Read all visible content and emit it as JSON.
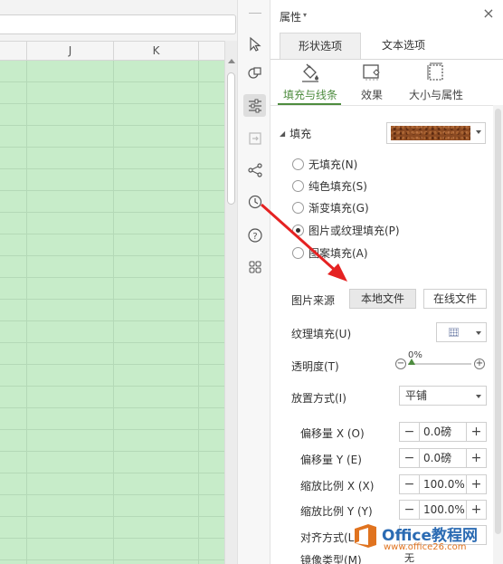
{
  "sheet": {
    "columns": [
      "J",
      "K"
    ]
  },
  "panel": {
    "title": "属性",
    "title_caret": "▾",
    "close": "×",
    "tabs": [
      "形状选项",
      "文本选项"
    ],
    "subtabs": [
      "填充与线条",
      "效果",
      "大小与属性"
    ],
    "fill": {
      "section_label": "填充",
      "section_caret": "◢",
      "options": [
        {
          "label": "无填充(N)",
          "checked": false
        },
        {
          "label": "纯色填充(S)",
          "checked": false
        },
        {
          "label": "渐变填充(G)",
          "checked": false
        },
        {
          "label": "图片或纹理填充(P)",
          "checked": true
        },
        {
          "label": "图案填充(A)",
          "checked": false
        }
      ],
      "picture_source_label": "图片来源",
      "local_file_button": "本地文件",
      "online_file_button": "在线文件",
      "texture_label": "纹理填充(U)",
      "opacity_label": "透明度(T)",
      "opacity_value": "0%",
      "opacity_fraction": 0,
      "placement_label": "放置方式(I)",
      "placement_value": "平铺",
      "offset_x_label": "偏移量 X (O)",
      "offset_x_value": "0.0磅",
      "offset_y_label": "偏移量 Y (E)",
      "offset_y_value": "0.0磅",
      "scale_x_label": "缩放比例 X (X)",
      "scale_x_value": "100.0%",
      "scale_y_label": "缩放比例 Y (Y)",
      "scale_y_value": "100.0%",
      "align_label": "对齐方式(L)",
      "mirror_label": "镜像类型(M)",
      "mirror_value": "无"
    }
  },
  "watermark": {
    "title": "Office教程网",
    "url": "www.office26.com"
  },
  "colors": {
    "accent": "#4e8c3f",
    "grid_fill": "#c7ecc9",
    "arrow": "#e52222",
    "texture": "#8b4a22",
    "watermark_blue": "#2b6bb3",
    "watermark_orange": "#e0731f"
  },
  "icons": {
    "toolbar": [
      "cursor-icon",
      "shapes-icon",
      "settings-sliders-icon",
      "transform-icon",
      "share-icon",
      "history-icon",
      "help-icon",
      "apps-grid-icon"
    ],
    "subtabs": [
      "fill-bucket-icon",
      "effects-icon",
      "size-icon"
    ]
  }
}
